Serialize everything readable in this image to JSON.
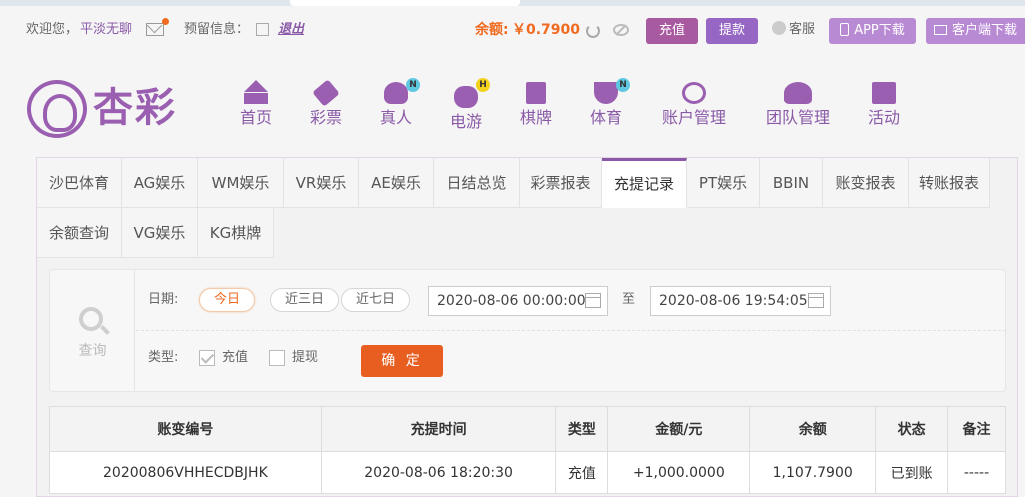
{
  "topbar": {
    "welcome": "欢迎您，",
    "username": "平淡无聊",
    "reserved_label": "预留信息：",
    "logout": "退出",
    "balance_label": "余额:",
    "balance_value": "￥0.7900",
    "charge": "充值",
    "withdraw": "提款",
    "service": "客服",
    "app_download": "APP下载",
    "client_download": "客户端下载"
  },
  "logo": {
    "text": "杏彩"
  },
  "nav": [
    {
      "label": "首页",
      "icon": "home-icon",
      "badge": ""
    },
    {
      "label": "彩票",
      "icon": "ticket-icon",
      "badge": ""
    },
    {
      "label": "真人",
      "icon": "live-dealer-icon",
      "badge": "N"
    },
    {
      "label": "电游",
      "icon": "gamepad-icon",
      "badge": "H"
    },
    {
      "label": "棋牌",
      "icon": "cards-icon",
      "badge": ""
    },
    {
      "label": "体育",
      "icon": "trophy-icon",
      "badge": "N"
    },
    {
      "label": "账户管理",
      "icon": "yen-coin-icon",
      "badge": ""
    },
    {
      "label": "团队管理",
      "icon": "team-icon",
      "badge": ""
    },
    {
      "label": "活动",
      "icon": "gift-icon",
      "badge": ""
    }
  ],
  "tabs": [
    {
      "label": "沙巴体育"
    },
    {
      "label": "AG娱乐"
    },
    {
      "label": "WM娱乐"
    },
    {
      "label": "VR娱乐"
    },
    {
      "label": "AE娱乐"
    },
    {
      "label": "日结总览"
    },
    {
      "label": "彩票报表"
    },
    {
      "label": "充提记录"
    },
    {
      "label": "PT娱乐"
    },
    {
      "label": "BBIN"
    },
    {
      "label": "账变报表"
    },
    {
      "label": "转账报表"
    },
    {
      "label": "余额查询"
    },
    {
      "label": "VG娱乐"
    },
    {
      "label": "KG棋牌"
    }
  ],
  "active_tab": "充提记录",
  "query": {
    "side_label": "查询",
    "date_label": "日期:",
    "ranges": [
      "今日",
      "近三日",
      "近七日"
    ],
    "selected_range": "今日",
    "start": "2020-08-06 00:00:00",
    "to": "至",
    "end": "2020-08-06 19:54:05",
    "type_label": "类型:",
    "type_charge": "充值",
    "type_withdraw": "提现",
    "type_charge_checked": true,
    "type_withdraw_checked": false,
    "confirm": "确 定"
  },
  "table": {
    "headers": [
      "账变编号",
      "充提时间",
      "类型",
      "金额/元",
      "余额",
      "状态",
      "备注"
    ],
    "rows": [
      [
        "20200806VHHECDBJHK",
        "2020-08-06 18:20:30",
        "充值",
        "+1,000.0000",
        "1,107.7900",
        "已到账",
        "-----"
      ]
    ]
  },
  "colors": {
    "brand": "#9a5fb0",
    "accent": "#f06b20",
    "positive_amount": "#e02020",
    "status_ok": "#3ca03c"
  }
}
